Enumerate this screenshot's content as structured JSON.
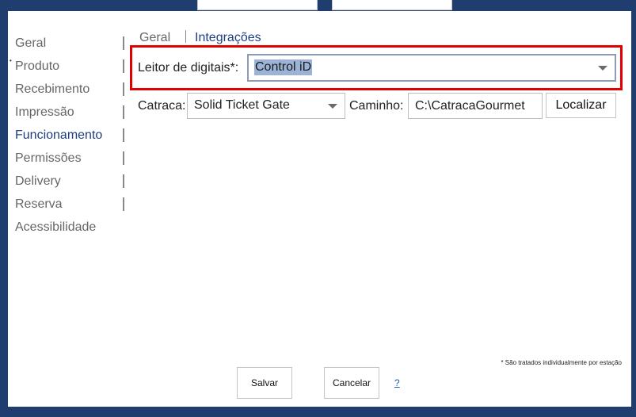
{
  "nav": {
    "items": [
      {
        "label": "Geral"
      },
      {
        "label": "Produto"
      },
      {
        "label": "Recebimento"
      },
      {
        "label": "Impressão"
      },
      {
        "label": "Funcionamento"
      },
      {
        "label": "Permissões"
      },
      {
        "label": "Delivery"
      },
      {
        "label": "Reserva"
      },
      {
        "label": "Acessibilidade"
      }
    ],
    "active": "Funcionamento"
  },
  "subtabs": {
    "geral": "Geral",
    "integracoes": "Integrações",
    "active": "Integrações"
  },
  "form": {
    "leitor_label": "Leitor de digitais*:",
    "leitor_value": "Control iD",
    "catraca_label": "Catraca:",
    "catraca_value": "Solid Ticket Gate",
    "caminho_label": "Caminho:",
    "caminho_value": "C:\\CatracaGourmet",
    "localizar_label": "Localizar"
  },
  "footer": {
    "note": "* São tratados individualmente por estação",
    "save_label": "Salvar",
    "cancel_label": "Cancelar",
    "help_label": "?"
  },
  "colors": {
    "background": "#1f3e6f",
    "accent": "#1f3e80",
    "highlight": "#e00000",
    "selection": "#9cb3d8"
  }
}
